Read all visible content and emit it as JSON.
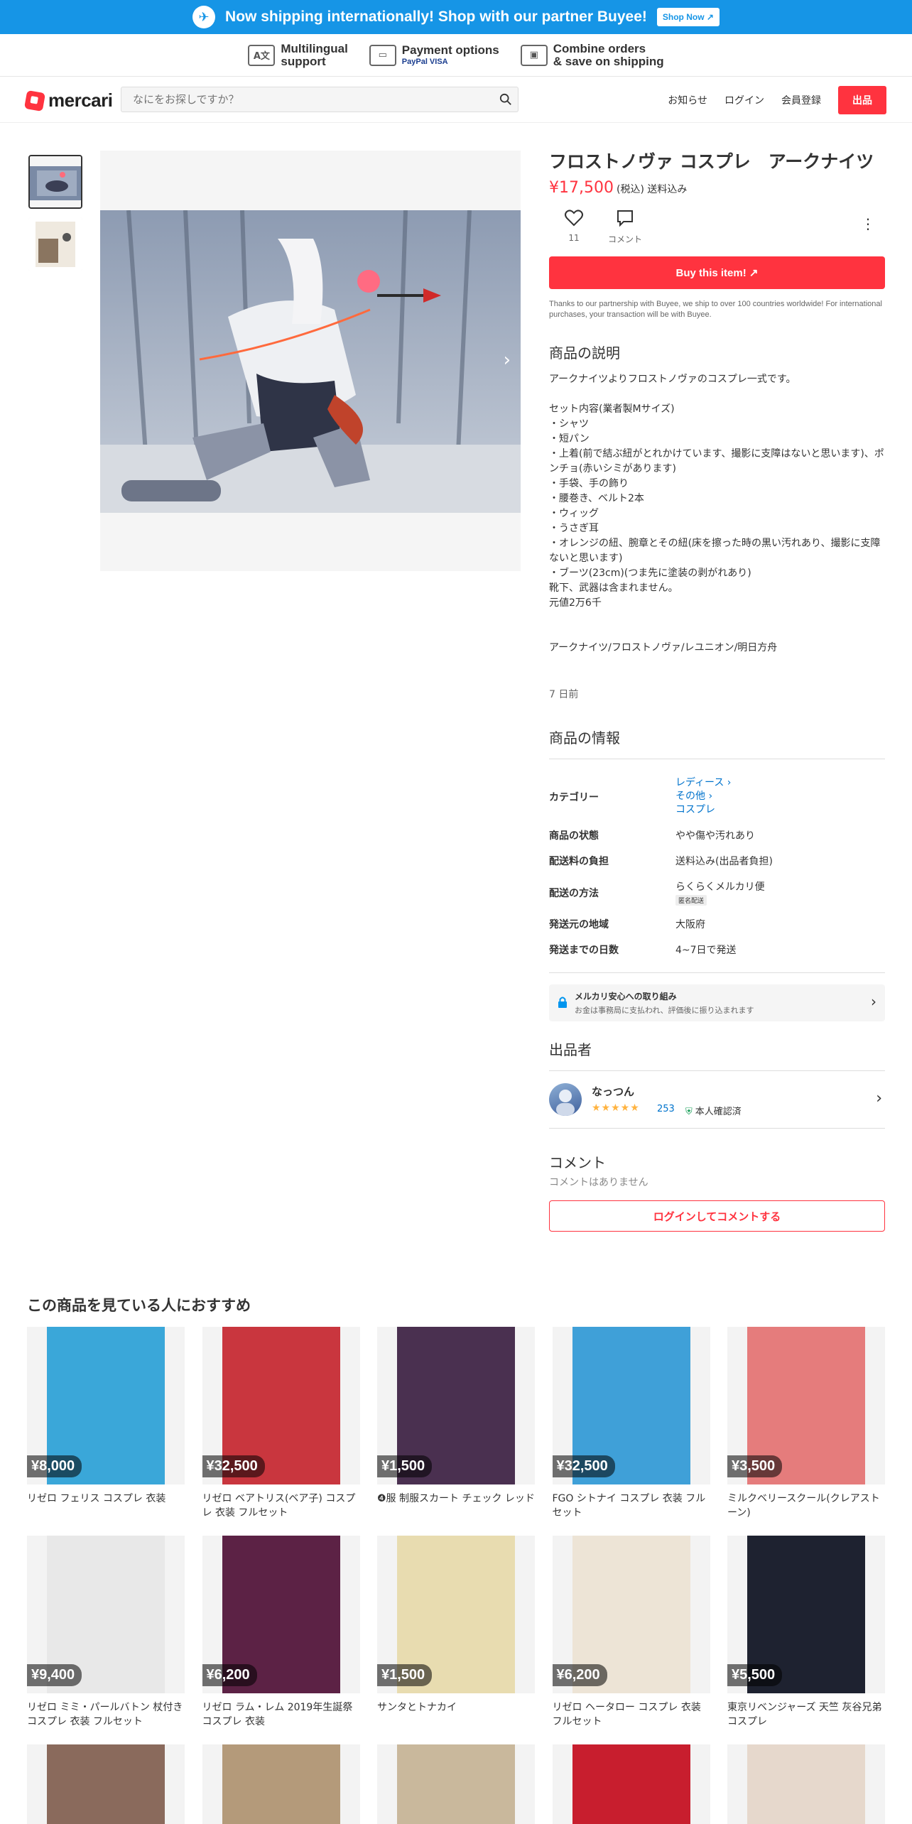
{
  "banner": {
    "message": "Now shipping internationally! Shop with our partner Buyee!",
    "shop_now": "Shop Now"
  },
  "features": [
    {
      "icon": "multilingual-icon",
      "line1": "Multilingual",
      "line2": "support"
    },
    {
      "icon": "payment-icon",
      "line1": "Payment options",
      "line2": "PayPal VISA"
    },
    {
      "icon": "combine-icon",
      "line1": "Combine orders",
      "line2": "& save on shipping"
    }
  ],
  "header": {
    "logo": "mercari",
    "search_placeholder": "なにをお探しですか？",
    "nav": [
      "お知らせ",
      "ログイン",
      "会員登録"
    ],
    "sell": "出品"
  },
  "item": {
    "title": "フロストノヴァ コスプレ　アークナイツ",
    "price": "¥17,500",
    "tax": "(税込) 送料込み",
    "likes": "11",
    "comment_label": "コメント",
    "buy": "Buy this item!",
    "buyee_note": "Thanks to our partnership with Buyee, we ship to over 100 countries worldwide! For international purchases, your transaction will be with Buyee.",
    "desc_heading": "商品の説明",
    "description": "アークナイツよりフロストノヴァのコスプレ一式です。\n\nセット内容(業者製Mサイズ)\n・シャツ\n・短パン\n・上着(前で結ぶ紐がとれかけています、撮影に支障はないと思います)、ポンチョ(赤いシミがあります)\n・手袋、手の飾り\n・腰巻き、ベルト2本\n・ウィッグ\n・うさぎ耳\n・オレンジの紐、腕章とその紐(床を擦った時の黒い汚れあり、撮影に支障ないと思います)\n・ブーツ(23cm)(つま先に塗装の剥がれあり)\n靴下、武器は含まれません。\n元値2万6千\n\n\nアークナイツ/フロストノヴァ/レユニオン/明日方舟",
    "posted": "7 日前",
    "info_heading": "商品の情報",
    "info": {
      "category_label": "カテゴリー",
      "categories": [
        "レディース",
        "その他",
        "コスプレ"
      ],
      "rows": [
        {
          "k": "商品の状態",
          "v": "やや傷や汚れあり"
        },
        {
          "k": "配送料の負担",
          "v": "送料込み(出品者負担)"
        },
        {
          "k": "配送の方法",
          "v": "らくらくメルカリ便",
          "badge": "匿名配送"
        },
        {
          "k": "発送元の地域",
          "v": "大阪府"
        },
        {
          "k": "発送までの日数",
          "v": "4~7日で発送"
        }
      ]
    },
    "safety": {
      "title": "メルカリ安心への取り組み",
      "text": "お金は事務局に支払われ、評価後に振り込まれます"
    },
    "seller_heading": "出品者",
    "seller": {
      "name": "なっつん",
      "rating": "253",
      "verified": "本人確認済"
    },
    "comments_heading": "コメント",
    "no_comments": "コメントはありません",
    "login_comment": "ログインしてコメントする"
  },
  "recommend": {
    "heading": "この商品を見ている人におすすめ",
    "items": [
      {
        "price": "¥8,000",
        "name": "リゼロ フェリス コスプレ 衣装",
        "bg": "#3aa7d9"
      },
      {
        "price": "¥32,500",
        "name": "リゼロ ベアトリス(ベア子) コスプレ 衣装 フルセット",
        "bg": "#c9363e"
      },
      {
        "price": "¥1,500",
        "name": "❹服 制服スカート チェック レッド",
        "bg": "#4a3050"
      },
      {
        "price": "¥32,500",
        "name": "FGO シトナイ コスプレ 衣装 フルセット",
        "bg": "#3fa0d8"
      },
      {
        "price": "¥3,500",
        "name": "ミルクベリースクール(クレアストーン)",
        "bg": "#e57c7c"
      },
      {
        "price": "¥9,400",
        "name": "リゼロ ミミ・パールバトン 杖付き コスプレ 衣装 フルセット",
        "bg": "#e8e8e8"
      },
      {
        "price": "¥6,200",
        "name": "リゼロ ラム・レム 2019年生誕祭 コスプレ 衣装",
        "bg": "#5c2245"
      },
      {
        "price": "¥1,500",
        "name": "サンタとトナカイ",
        "bg": "#e8dcb0"
      },
      {
        "price": "¥6,200",
        "name": "リゼロ ヘータロー コスプレ 衣装 フルセット",
        "bg": "#ede4d6"
      },
      {
        "price": "¥5,500",
        "name": "東京リベンジャーズ 天竺 灰谷兄弟 コスプレ",
        "bg": "#1e2230"
      },
      {
        "price": "",
        "name": "",
        "bg": "#8a6a5c"
      },
      {
        "price": "",
        "name": "",
        "bg": "#b49a7a"
      },
      {
        "price": "",
        "name": "",
        "bg": "#c9b89c"
      },
      {
        "price": "",
        "name": "",
        "bg": "#c81e2e"
      },
      {
        "price": "",
        "name": "",
        "bg": "#e6d8cc"
      }
    ]
  }
}
